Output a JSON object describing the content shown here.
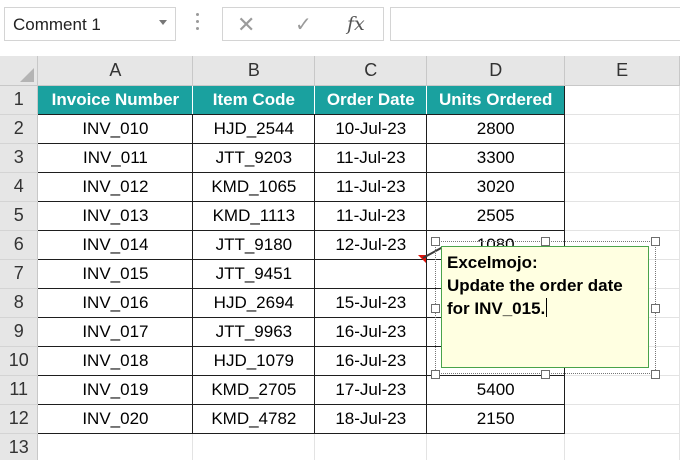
{
  "name_box": {
    "value": "Comment 1"
  },
  "formula_bar": {
    "cancel_glyph": "✕",
    "enter_glyph": "✓",
    "fx_label": "fx",
    "content": ""
  },
  "columns": [
    "A",
    "B",
    "C",
    "D",
    "E"
  ],
  "rows": [
    "1",
    "2",
    "3",
    "4",
    "5",
    "6",
    "7",
    "8",
    "9",
    "10",
    "11",
    "12",
    "13"
  ],
  "table": {
    "headers": [
      "Invoice Number",
      "Item Code",
      "Order Date",
      "Units Ordered"
    ],
    "header_color": "#1aa19f",
    "data": [
      [
        "INV_010",
        "HJD_2544",
        "10-Jul-23",
        "2800"
      ],
      [
        "INV_011",
        "JTT_9203",
        "11-Jul-23",
        "3300"
      ],
      [
        "INV_012",
        "KMD_1065",
        "11-Jul-23",
        "3020"
      ],
      [
        "INV_013",
        "KMD_1113",
        "11-Jul-23",
        "2505"
      ],
      [
        "INV_014",
        "JTT_9180",
        "12-Jul-23",
        "1080"
      ],
      [
        "INV_015",
        "JTT_9451",
        "",
        ""
      ],
      [
        "INV_016",
        "HJD_2694",
        "15-Jul-23",
        ""
      ],
      [
        "INV_017",
        "JTT_9963",
        "16-Jul-23",
        ""
      ],
      [
        "INV_018",
        "HJD_1079",
        "16-Jul-23",
        ""
      ],
      [
        "INV_019",
        "KMD_2705",
        "17-Jul-23",
        "5400"
      ],
      [
        "INV_020",
        "KMD_4782",
        "18-Jul-23",
        "2150"
      ]
    ]
  },
  "comment": {
    "author": "Excelmojo:",
    "line1": "Update the order date",
    "line2": "for INV_015.",
    "indicator_color": "#e0120a",
    "background_color": "#ffffe1"
  }
}
